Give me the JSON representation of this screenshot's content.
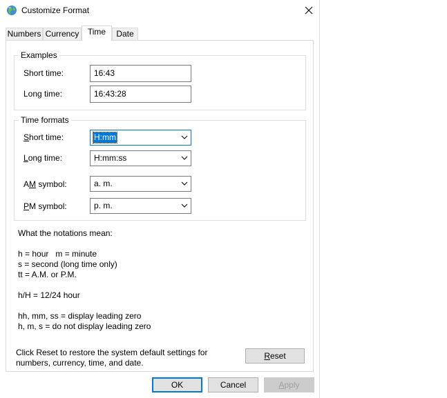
{
  "window": {
    "title": "Customize Format"
  },
  "tabs": [
    {
      "label": "Numbers"
    },
    {
      "label": "Currency"
    },
    {
      "label": "Time"
    },
    {
      "label": "Date"
    }
  ],
  "examples": {
    "legend": "Examples",
    "short_label": "Short time:",
    "short_value": "16:43",
    "long_label": "Long time:",
    "long_value": "16:43:28"
  },
  "formats": {
    "legend": "Time formats",
    "short_label_pre": "",
    "short_label_key": "S",
    "short_label_post": "hort time:",
    "short_value": "H:mm",
    "long_label_key": "L",
    "long_label_post": "ong time:",
    "long_value": "H:mm:ss",
    "am_label_pre": "A",
    "am_label_key": "M",
    "am_label_post": " symbol:",
    "am_value": "a. m.",
    "pm_label_key": "P",
    "pm_label_post": "M symbol:",
    "pm_value": "p. m."
  },
  "notes": [
    "What the notations mean:",
    "",
    "h = hour   m = minute",
    "s = second (long time only)",
    "tt = A.M. or P.M.",
    "",
    "h/H = 12/24 hour",
    "",
    "hh, mm, ss = display leading zero",
    "h, m, s = do not display leading zero"
  ],
  "reset_info": [
    "Click Reset to restore the system default settings for",
    "numbers, currency, time, and date."
  ],
  "buttons": {
    "reset_key": "R",
    "reset_rest": "eset",
    "ok": "OK",
    "cancel": "Cancel",
    "apply_key": "A",
    "apply_rest": "pply"
  },
  "colors": {
    "accent": "#0078d7",
    "border": "#d9d9d9",
    "button": "#e1e1e1"
  }
}
